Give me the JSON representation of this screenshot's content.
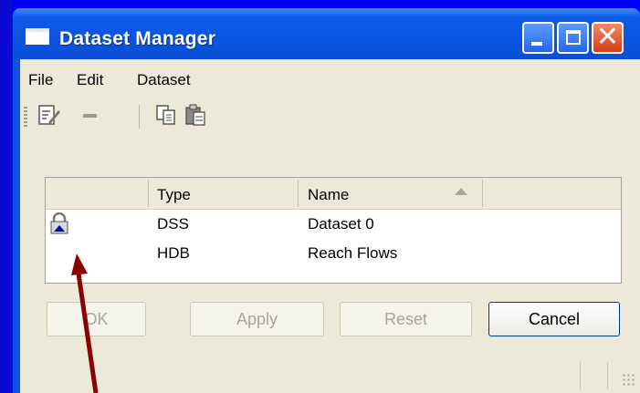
{
  "window": {
    "title": "Dataset Manager"
  },
  "menu": {
    "items": [
      "File",
      "Edit",
      "Dataset"
    ]
  },
  "table": {
    "columns": [
      "Type",
      "Name"
    ],
    "rows": [
      {
        "locked": true,
        "type": "DSS",
        "name": "Dataset 0"
      },
      {
        "locked": false,
        "type": "HDB",
        "name": "Reach Flows"
      }
    ]
  },
  "buttons": {
    "ok": "OK",
    "apply": "Apply",
    "reset": "Reset",
    "cancel": "Cancel"
  },
  "colors": {
    "slide_background": "#0000ff",
    "arrow": "#8b0000",
    "title_bar": "#0a54e0",
    "dialog": "#ece9d8"
  },
  "icons": [
    "window-icon",
    "minimize-icon",
    "maximize-icon",
    "close-icon",
    "edit-icon",
    "remove-icon",
    "copy-icon",
    "paste-icon",
    "lock-icon",
    "sort-ascending-icon",
    "resize-grip-icon"
  ]
}
